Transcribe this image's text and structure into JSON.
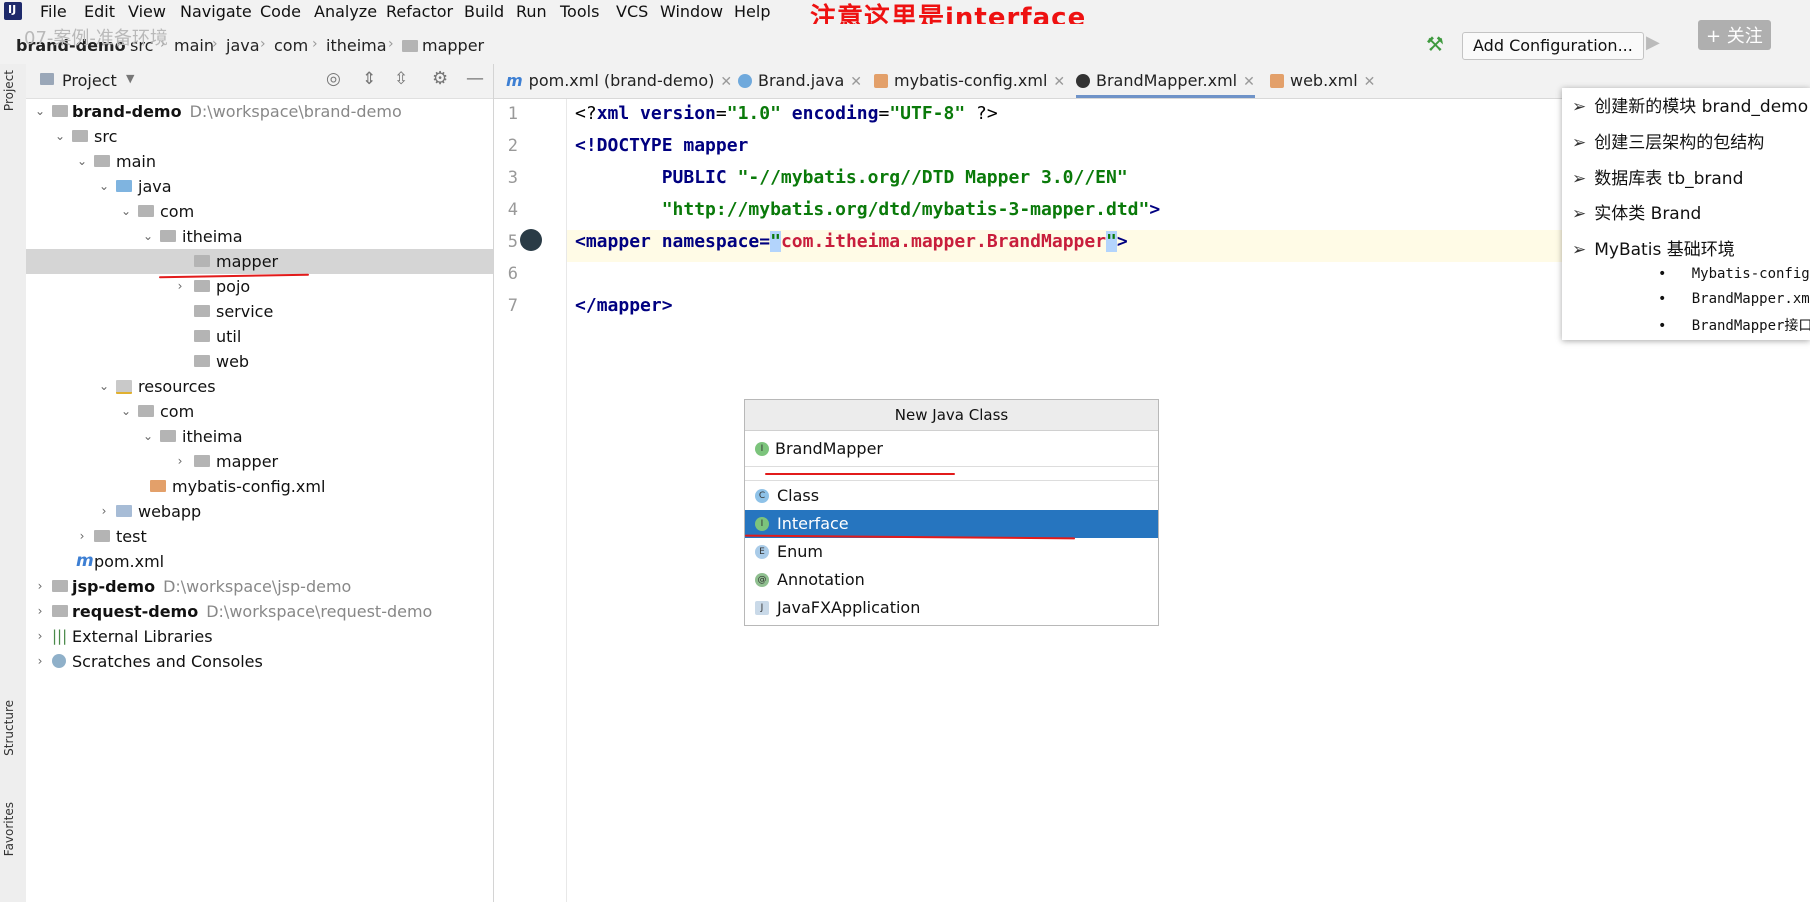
{
  "menubar": {
    "items": [
      "File",
      "Edit",
      "View",
      "Navigate",
      "Code",
      "Analyze",
      "Refactor",
      "Build",
      "Run",
      "Tools",
      "VCS",
      "Window",
      "Help"
    ],
    "notice": "注意这里是interface",
    "follow": "+ 关注",
    "overlay": "07-案例-准备环境"
  },
  "navbar": {
    "breadcrumb": [
      "brand-demo",
      "src",
      "main",
      "java",
      "com",
      "itheima",
      "mapper"
    ],
    "add_configuration": "Add Configuration..."
  },
  "leftstrip": {
    "project_tab": "Project",
    "structure_tab": "Structure",
    "favorites_tab": "Favorites"
  },
  "project": {
    "title": "Project",
    "tree": [
      {
        "label": "brand-demo",
        "path": "D:\\workspace\\brand-demo"
      },
      {
        "label": "src"
      },
      {
        "label": "main"
      },
      {
        "label": "java"
      },
      {
        "label": "com"
      },
      {
        "label": "itheima"
      },
      {
        "label": "mapper"
      },
      {
        "label": "pojo"
      },
      {
        "label": "service"
      },
      {
        "label": "util"
      },
      {
        "label": "web"
      },
      {
        "label": "resources"
      },
      {
        "label": "com"
      },
      {
        "label": "itheima"
      },
      {
        "label": "mapper"
      },
      {
        "label": "mybatis-config.xml"
      },
      {
        "label": "webapp"
      },
      {
        "label": "test"
      },
      {
        "label": "pom.xml"
      },
      {
        "label": "jsp-demo",
        "path": "D:\\workspace\\jsp-demo"
      },
      {
        "label": "request-demo",
        "path": "D:\\workspace\\request-demo"
      },
      {
        "label": "External Libraries"
      },
      {
        "label": "Scratches and Consoles"
      }
    ]
  },
  "tabs": [
    "pom.xml (brand-demo)",
    "Brand.java",
    "mybatis-config.xml",
    "BrandMapper.xml",
    "web.xml"
  ],
  "editor": {
    "line_numbers": [
      "1",
      "2",
      "3",
      "4",
      "5",
      "6",
      "7"
    ],
    "l1": {
      "a": "<?",
      "b": "xml version",
      "c": "=",
      "d": "\"1.0\"",
      "e": " encoding",
      "f": "=",
      "g": "\"UTF-8\"",
      "h": " ?>"
    },
    "l2": {
      "a": "<!DOCTYPE ",
      "b": "mapper"
    },
    "l3": {
      "a": "        PUBLIC ",
      "b": "\"-//mybatis.org//DTD Mapper 3.0//EN\""
    },
    "l4": {
      "a": "        \"http://mybatis.org/dtd/mybatis-3-mapper.dtd\"",
      "b": ">"
    },
    "l5": {
      "a": "<",
      "b": "mapper",
      "c": " namespace",
      "d": "=",
      "e": "\"",
      "f": "com.itheima.mapper.BrandMapper",
      "g": "\"",
      "h": ">"
    },
    "l7": {
      "a": "</",
      "b": "mapper",
      "c": ">"
    }
  },
  "notes": {
    "items": [
      "创建新的模块 brand_demo",
      "创建三层架构的包结构",
      "数据库表 tb_brand",
      "实体类 Brand",
      "MyBatis 基础环境"
    ],
    "subitems": [
      "Mybatis-config.xml",
      "BrandMapper.xml",
      "BrandMapper接口"
    ]
  },
  "dialog": {
    "title": "New Java Class",
    "input_value": "BrandMapper",
    "kinds": [
      {
        "icon": "C",
        "label": "Class"
      },
      {
        "icon": "I",
        "label": "Interface"
      },
      {
        "icon": "E",
        "label": "Enum"
      },
      {
        "icon": "@",
        "label": "Annotation"
      },
      {
        "icon": "J",
        "label": "JavaFXApplication"
      }
    ],
    "selected": "Interface"
  },
  "colors": {
    "selection": "#2675bf",
    "annotation_red": "#e21b1b",
    "keyword": "#000080",
    "string": "#0a7a0a"
  }
}
